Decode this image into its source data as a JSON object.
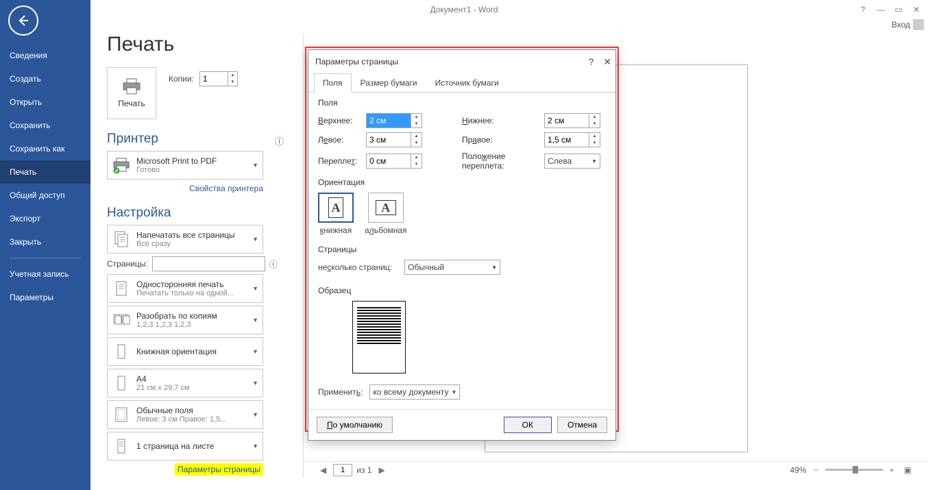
{
  "titlebar": {
    "title": "Документ1 - Word",
    "user": "Вход"
  },
  "sidebar": {
    "items": [
      {
        "label": "Сведения"
      },
      {
        "label": "Создать"
      },
      {
        "label": "Открыть"
      },
      {
        "label": "Сохранить"
      },
      {
        "label": "Сохранить как"
      },
      {
        "label": "Печать",
        "active": true
      },
      {
        "label": "Общий доступ"
      },
      {
        "label": "Экспорт"
      },
      {
        "label": "Закрыть"
      }
    ],
    "items2": [
      {
        "label": "Учетная запись"
      },
      {
        "label": "Параметры"
      }
    ]
  },
  "print": {
    "title": "Печать",
    "button": "Печать",
    "copies_label": "Копии:",
    "copies": "1",
    "printer_heading": "Принтер",
    "printer_name": "Microsoft Print to PDF",
    "printer_status": "Готово",
    "printer_props": "Свойства принтера",
    "settings_heading": "Настройка",
    "opts": [
      {
        "l1": "Напечатать все страницы",
        "l2": "Все сразу"
      },
      {
        "l1": "Односторонняя печать",
        "l2": "Печатать только на одной..."
      },
      {
        "l1": "Разобрать по копиям",
        "l2": "1,2,3    1,2,3    1,2,3"
      },
      {
        "l1": "Книжная ориентация",
        "l2": ""
      },
      {
        "l1": "A4",
        "l2": "21 см x 29,7 см"
      },
      {
        "l1": "Обычные поля",
        "l2": "Левое:  3 см   Правое:  1,5..."
      },
      {
        "l1": "1 страница на листе",
        "l2": ""
      }
    ],
    "pages_label": "Страницы:",
    "page_setup_link": "Параметры страницы"
  },
  "dialog": {
    "title": "Параметры страницы",
    "tabs": [
      "Поля",
      "Размер бумаги",
      "Источник бумаги"
    ],
    "margins_label": "Поля",
    "top_lbl": "Верхнее:",
    "top_val": "2 см",
    "bottom_lbl": "Нижнее:",
    "bottom_val": "2 см",
    "left_lbl": "Левое:",
    "left_val": "3 см",
    "right_lbl": "Правое:",
    "right_val": "1,5 см",
    "gutter_lbl": "Переплет:",
    "gutter_val": "0 см",
    "gutter_pos_lbl": "Положение переплета:",
    "gutter_pos_val": "Слева",
    "orientation_label": "Ориентация",
    "portrait": "книжная",
    "landscape": "альбомная",
    "pages_label": "Страницы",
    "multi_lbl": "несколько страниц:",
    "multi_val": "Обычный",
    "sample_label": "Образец",
    "apply_lbl": "Применить:",
    "apply_val": "ко всему документу",
    "default_btn": "По умолчанию",
    "ok_btn": "ОК",
    "cancel_btn": "Отмена"
  },
  "footer": {
    "page": "1",
    "of_label": "из 1",
    "zoom": "49%"
  }
}
